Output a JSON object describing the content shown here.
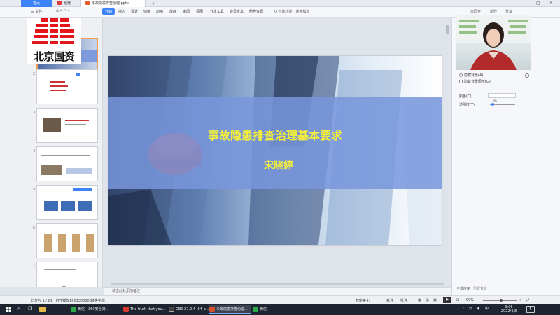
{
  "tabs": {
    "home": "首页",
    "straw": "稻壳",
    "doc": "事故隐患排查治理.pptx",
    "add": "+"
  },
  "menu": {
    "file": "三 文件",
    "items": [
      "开始",
      "插入",
      "设计",
      "切换",
      "动画",
      "放映",
      "审阅",
      "视图",
      "开发工具",
      "会员专享",
      "稻壳资源"
    ],
    "search": "Q 查找功能、搜索模板",
    "right": [
      "未同步",
      "协作",
      "分享"
    ]
  },
  "logo": {
    "text": "北京国资"
  },
  "thumbs": {
    "numbers": [
      "1",
      "2",
      "3",
      "4",
      "5",
      "6",
      "7"
    ],
    "add": "+"
  },
  "slide": {
    "title": "事故隐患排查治理基本要求",
    "author": "宋晓婷"
  },
  "notes": {
    "placeholder": "单击此处添加备注"
  },
  "rpanel": {
    "opt1": "隐藏背景(A)",
    "opt2": "隐藏背景图形(G)",
    "color_label": "颜色(C)",
    "transparency_label": "透明度(T)",
    "transparency_value": "0%",
    "apply_all": "全部应用",
    "reset": "重置背景"
  },
  "status": {
    "slide_counter": "幻灯片 1 / 61",
    "template": "PPT模板1601300000",
    "missing_font": "缺失字体",
    "beautify": "智能美化",
    "notes_btn": "备注",
    "comment_btn": "批注",
    "zoom": "99%"
  },
  "taskbar": {
    "items": [
      "微信 - 360安全浏...",
      "The truth that you...",
      "OBS 27.2.4 (64-bi...",
      "事故隐患排查治理...",
      "微信"
    ],
    "item_colors": [
      "#2aa84a",
      "#d83a2e",
      "#444444",
      "#d8512e",
      "#2aa84a"
    ],
    "time": "9:06",
    "date": "2022/4/8",
    "ime": "中",
    "notify_count": "5"
  }
}
